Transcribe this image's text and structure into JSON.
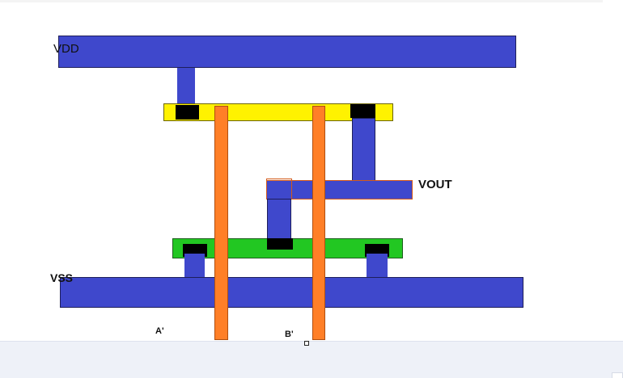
{
  "labels": {
    "vdd": "VDD",
    "vss": "VSS",
    "vout": "VOUT",
    "input_a": "A'",
    "input_b": "B'"
  },
  "colors": {
    "metal": "#3f48cc",
    "poly": "#ff7f27",
    "p_diffusion": "#fff200",
    "n_diffusion": "#22c722",
    "contact": "#000000"
  }
}
